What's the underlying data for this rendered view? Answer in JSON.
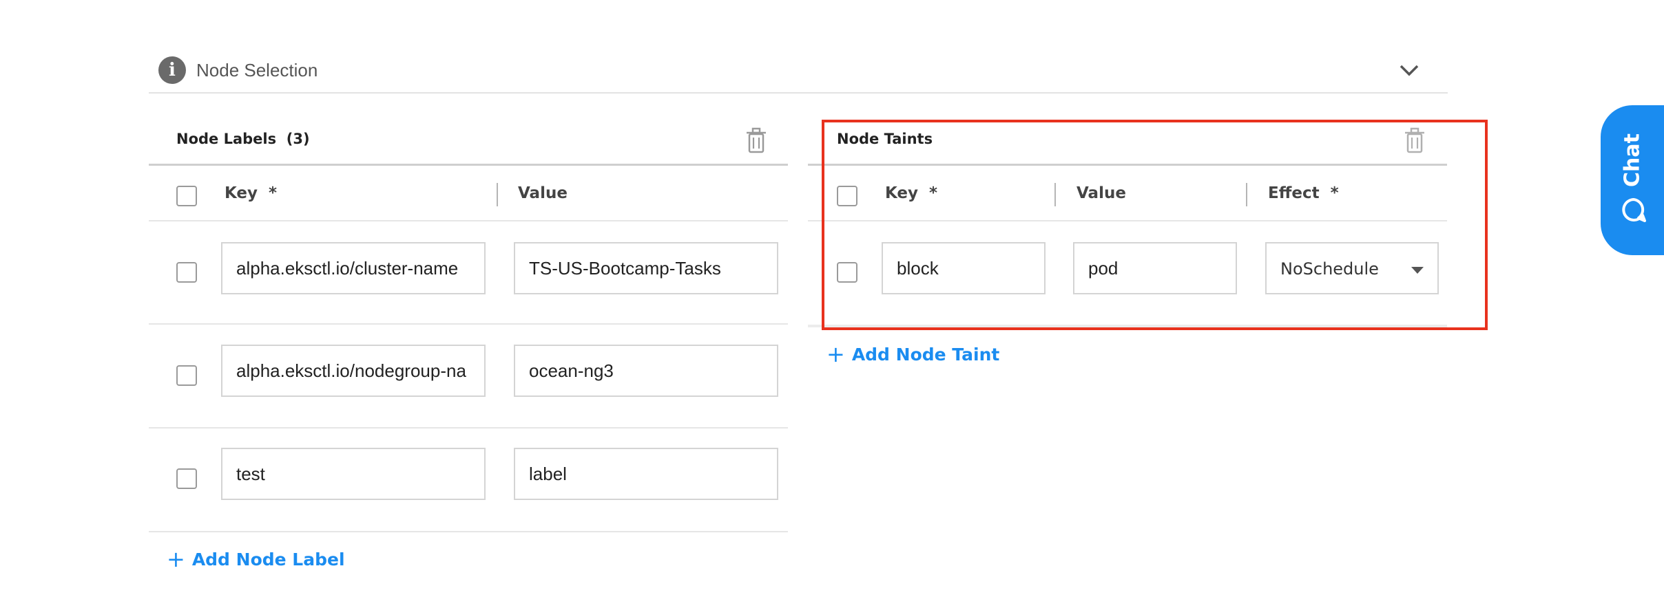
{
  "section": {
    "title": "Node Selection",
    "info_icon": "info-icon",
    "toggle_icon": "chevron-down-icon"
  },
  "node_labels": {
    "title": "Node Labels",
    "count": "(3)",
    "delete_icon": "trash-icon",
    "columns": {
      "key": "Key",
      "value": "Value",
      "required_mark": "*"
    },
    "rows": [
      {
        "key": "alpha.eksctl.io/cluster-name",
        "value": "TS-US-Bootcamp-Tasks"
      },
      {
        "key": "alpha.eksctl.io/nodegroup-na",
        "value": "ocean-ng3"
      },
      {
        "key": "test",
        "value": "label"
      }
    ],
    "add_label": "Add Node Label"
  },
  "node_taints": {
    "title": "Node Taints",
    "delete_icon": "trash-icon",
    "columns": {
      "key": "Key",
      "value": "Value",
      "effect": "Effect",
      "required_mark": "*"
    },
    "rows": [
      {
        "key": "block",
        "value": "pod",
        "effect": "NoSchedule"
      }
    ],
    "add_label": "Add Node Taint"
  },
  "chat": {
    "label": "Chat",
    "icon": "chat-bubble-icon"
  },
  "colors": {
    "accent": "#1a8cf0",
    "highlight": "#e8321e",
    "info_icon": "#6a6a6a"
  }
}
